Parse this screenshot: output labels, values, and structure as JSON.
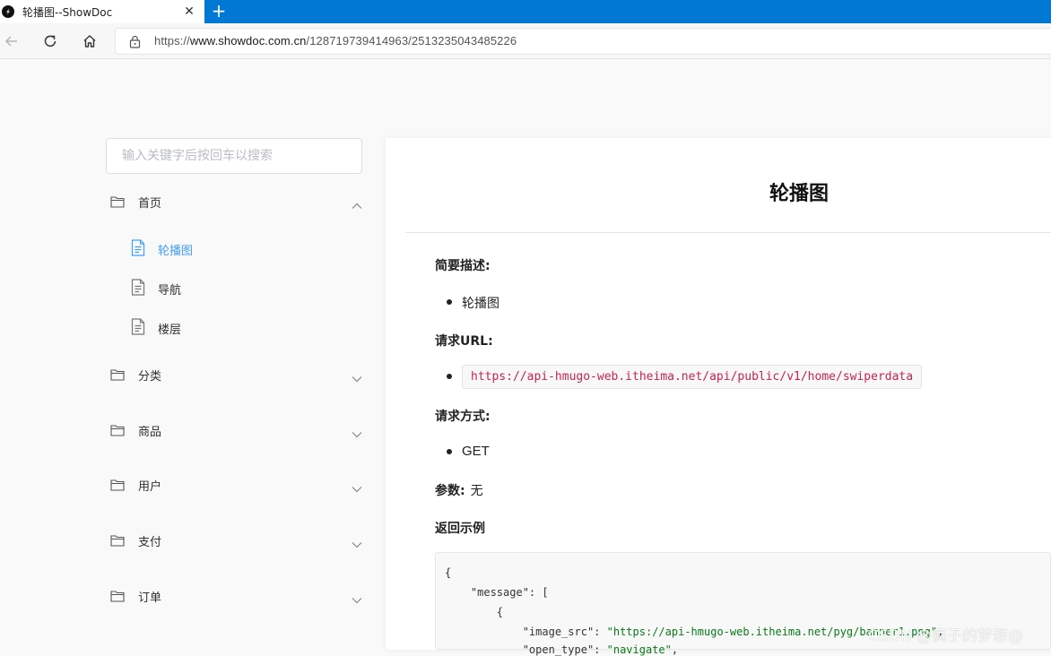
{
  "browser": {
    "tab_title": "轮播图--ShowDoc",
    "url_scheme": "https://",
    "url_host": "www.showdoc.com.cn",
    "url_path": "/128719739414963/2513235043485226"
  },
  "sidebar": {
    "search_placeholder": "输入关键字后按回车以搜索",
    "categories": [
      {
        "label": "首页",
        "expanded": true,
        "pages": [
          "轮播图",
          "导航",
          "楼层"
        ],
        "active_page": "轮播图"
      },
      {
        "label": "分类",
        "expanded": false
      },
      {
        "label": "商品",
        "expanded": false
      },
      {
        "label": "用户",
        "expanded": false
      },
      {
        "label": "支付",
        "expanded": false
      },
      {
        "label": "订单",
        "expanded": false
      }
    ]
  },
  "doc": {
    "title": "轮播图",
    "desc_heading": "简要描述:",
    "desc_item": "轮播图",
    "url_heading": "请求URL:",
    "url_value": "https://api-hmugo-web.itheima.net/api/public/v1/home/swiperdata",
    "method_heading": "请求方式:",
    "method_value": "GET",
    "params_heading": "参数:",
    "params_value": "无",
    "example_heading": "返回示例",
    "code_lines": [
      "{",
      "    \"message\": [",
      "        {",
      "            \"image_src\": \"https://api-hmugo-web.itheima.net/pyg/banner1.png\",",
      "            \"open_type\": \"navigate\","
    ]
  },
  "watermark": "CSDN @疯子的梦想@",
  "colors": {
    "tab_strip": "#0078d4",
    "active_link": "#409eff",
    "inline_code": "#c7254e",
    "json_string": "#0a7a1a"
  },
  "icons": {
    "back": "arrow-left-icon",
    "reload": "refresh-icon",
    "home": "home-icon",
    "lock": "lock-icon",
    "folder": "folder-icon",
    "file": "document-icon",
    "chevron_up": "chevron-up-icon",
    "chevron_down": "chevron-down-icon"
  }
}
